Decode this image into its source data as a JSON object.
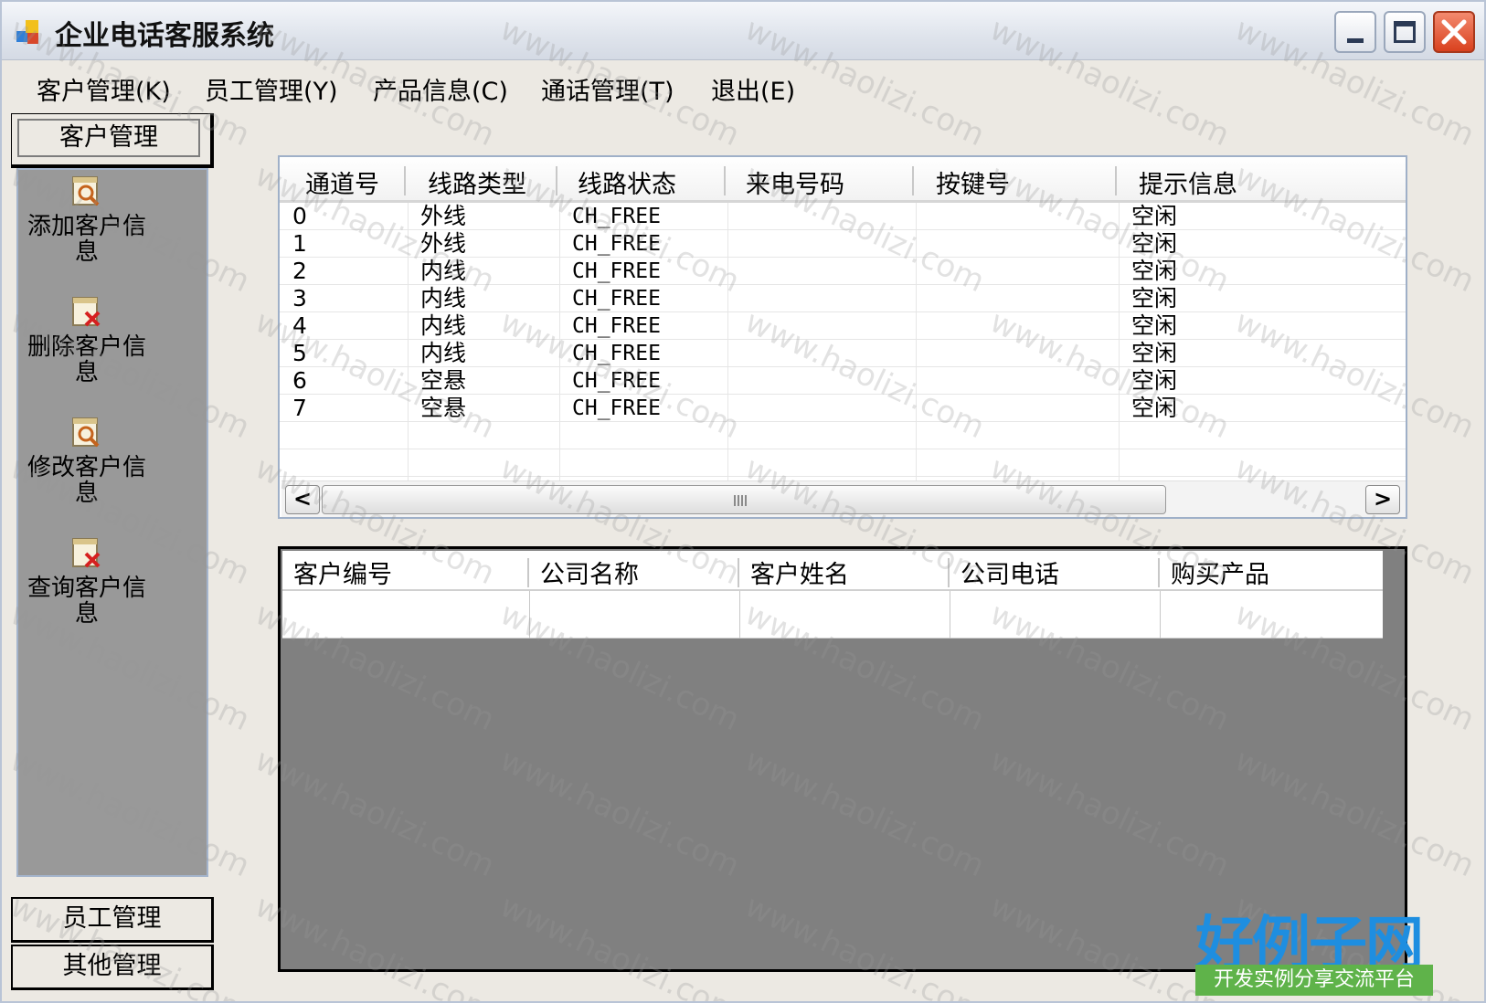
{
  "window": {
    "title": "企业电话客服系统"
  },
  "menu": [
    {
      "label": "客户管理(K)"
    },
    {
      "label": "员工管理(Y)"
    },
    {
      "label": "产品信息(C)"
    },
    {
      "label": "通话管理(T)"
    },
    {
      "label": "退出(E)"
    }
  ],
  "left_panel": {
    "header": "客户管理",
    "tools": [
      {
        "label": "添加客户信息",
        "icon": "magnifier-doc-icon"
      },
      {
        "label": "删除客户信息",
        "icon": "doc-x-icon"
      },
      {
        "label": "修改客户信息",
        "icon": "magnifier-doc-icon"
      },
      {
        "label": "查询客户信息",
        "icon": "doc-x-icon"
      }
    ],
    "bottom_buttons": [
      "员工管理",
      "其他管理"
    ]
  },
  "channel_grid": {
    "columns": [
      "通道号",
      "线路类型",
      "线路状态",
      "来电号码",
      "按键号",
      "提示信息"
    ],
    "rows": [
      [
        "0",
        "外线",
        "CH_FREE",
        "",
        "",
        "空闲"
      ],
      [
        "1",
        "外线",
        "CH_FREE",
        "",
        "",
        "空闲"
      ],
      [
        "2",
        "内线",
        "CH_FREE",
        "",
        "",
        "空闲"
      ],
      [
        "3",
        "内线",
        "CH_FREE",
        "",
        "",
        "空闲"
      ],
      [
        "4",
        "内线",
        "CH_FREE",
        "",
        "",
        "空闲"
      ],
      [
        "5",
        "内线",
        "CH_FREE",
        "",
        "",
        "空闲"
      ],
      [
        "6",
        "空悬",
        "CH_FREE",
        "",
        "",
        "空闲"
      ],
      [
        "7",
        "空悬",
        "CH_FREE",
        "",
        "",
        "空闲"
      ]
    ],
    "scroll_left": "<",
    "scroll_right": ">"
  },
  "customer_grid": {
    "columns": [
      "客户编号",
      "公司名称",
      "客户姓名",
      "公司电话",
      "购买产品"
    ]
  },
  "watermark": "www.haolizi.com",
  "logo": {
    "main": "好例子网",
    "sub": "开发实例分享交流平台"
  },
  "colors": {
    "panel": "#999999",
    "grid_bg": "#808080",
    "logo_blue": "#1e8ee0",
    "logo_green": "#5fb34a"
  }
}
